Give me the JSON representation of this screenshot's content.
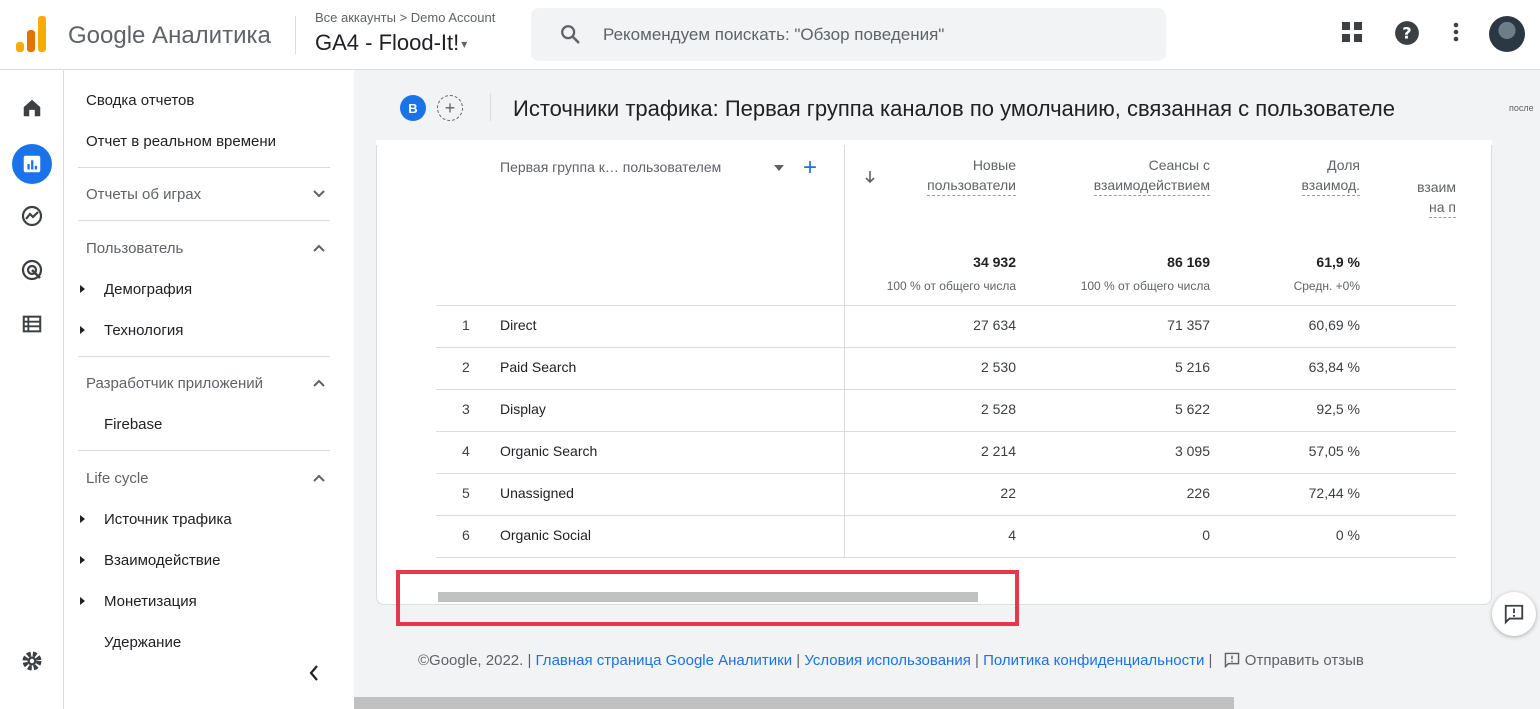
{
  "app": {
    "brand": "Google Аналитика",
    "breadcrumb": "Все аккаунты > Demo Account",
    "property": "GA4 - Flood-It!",
    "search_placeholder": "Рекомендуем поискать: \"Обзор поведения\""
  },
  "icons": {
    "search": "search-icon",
    "apps": "apps-grid-icon",
    "help": "help-icon",
    "more": "more-vert-icon"
  },
  "rail": [
    "home-icon",
    "reports-icon",
    "explore-icon",
    "advertising-icon",
    "configure-icon",
    "settings-icon"
  ],
  "sidebar": {
    "summary": "Сводка отчетов",
    "realtime": "Отчет в реальном времени",
    "games": "Отчеты об играх",
    "user": "Пользователь",
    "demography": "Демография",
    "technology": "Технология",
    "developer": "Разработчик приложений",
    "firebase": "Firebase",
    "lifecycle": "Life cycle",
    "traffic": "Источник трафика",
    "engagement": "Взаимодействие",
    "monetization": "Монетизация",
    "retention": "Удержание"
  },
  "report": {
    "compare_badge": "B",
    "title": "Источники трафика: Первая группа каналов по умолчанию, связанная с пользователе",
    "title_overflow": "после"
  },
  "table": {
    "dimension_header": "Первая группа к… пользователем",
    "columns": [
      {
        "line1": "Новые",
        "line2": "пользователи",
        "total": "34 932",
        "sub": "100 % от общего числа"
      },
      {
        "line1": "Сеансы с",
        "line2": "взаимодействием",
        "total": "86 169",
        "sub": "100 % от общего числа"
      },
      {
        "line1": "Доля",
        "line2": "взаимод.",
        "total": "61,9 %",
        "sub": "Средн. +0%"
      },
      {
        "line1": "взаим",
        "line2": "на п"
      }
    ],
    "rows": [
      {
        "n": "1",
        "name": "Direct",
        "v1": "27 634",
        "v2": "71 357",
        "v3": "60,69 %"
      },
      {
        "n": "2",
        "name": "Paid Search",
        "v1": "2 530",
        "v2": "5 216",
        "v3": "63,84 %"
      },
      {
        "n": "3",
        "name": "Display",
        "v1": "2 528",
        "v2": "5 622",
        "v3": "92,5 %"
      },
      {
        "n": "4",
        "name": "Organic Search",
        "v1": "2 214",
        "v2": "3 095",
        "v3": "57,05 %"
      },
      {
        "n": "5",
        "name": "Unassigned",
        "v1": "22",
        "v2": "226",
        "v3": "72,44 %"
      },
      {
        "n": "6",
        "name": "Organic Social",
        "v1": "4",
        "v2": "0",
        "v3": "0 %"
      }
    ]
  },
  "footer": {
    "copyright": "©Google, 2022.",
    "home": "Главная страница Google Аналитики",
    "terms": "Условия использования",
    "privacy": "Политика конфиденциальности",
    "feedback": "Отправить отзыв"
  },
  "colors": {
    "accent": "#1a73e8",
    "highlight": "#e8364d"
  }
}
